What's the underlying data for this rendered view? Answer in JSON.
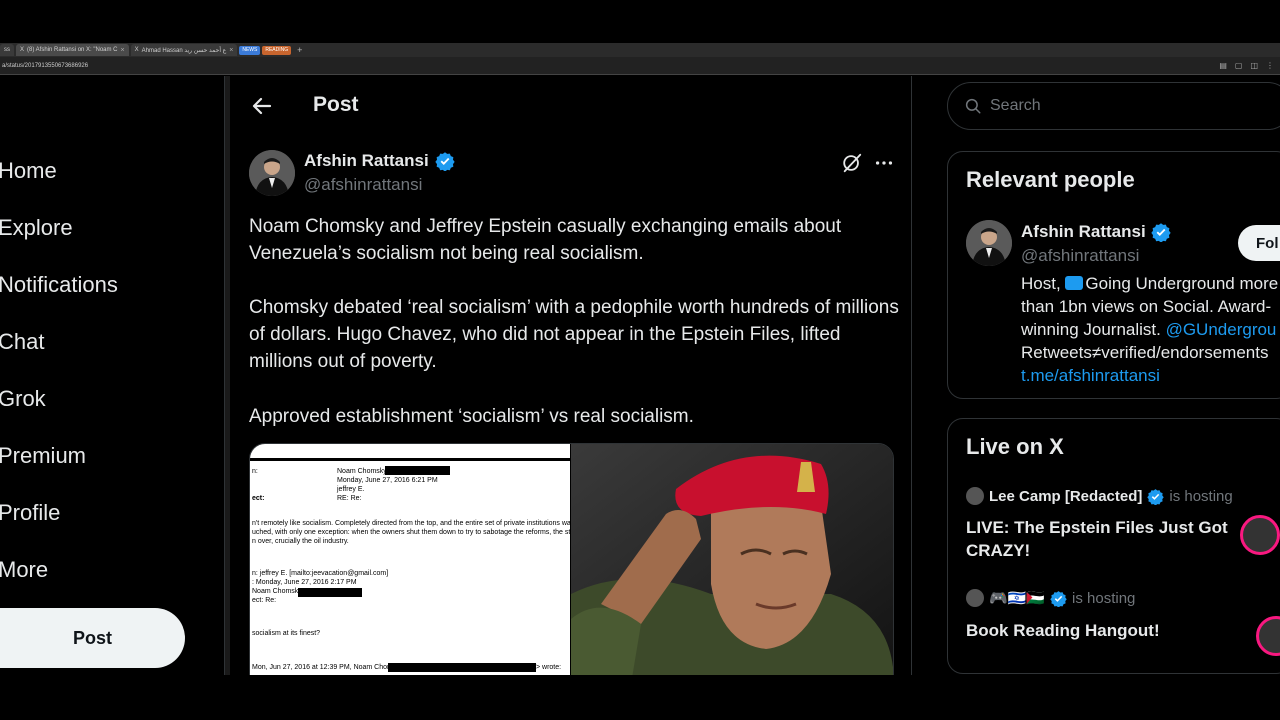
{
  "browser": {
    "tabs": [
      {
        "label": "ss"
      },
      {
        "label": "(8) Afshin Rattansi on X: \"Noam C"
      },
      {
        "label": "Ahmad Hassan ع أحمد حسن ريد"
      }
    ],
    "chips": [
      "NEWS",
      "READING"
    ],
    "new_tab": "+",
    "url": "a/status/2017913550673686926"
  },
  "nav": {
    "items": [
      "Home",
      "Explore",
      "Notifications",
      "Chat",
      "Grok",
      "Premium",
      "Profile",
      "More"
    ],
    "post_button": "Post"
  },
  "header": {
    "title": "Post"
  },
  "tweet": {
    "author_name": "Afshin Rattansi",
    "author_handle": "@afshinrattansi",
    "paragraphs": [
      "Noam Chomsky and Jeffrey Epstein casually exchanging emails about Venezuela’s socialism not being real socialism.",
      "Chomsky debated ‘real socialism’ with a pedophile worth hundreds of millions of dollars. Hugo Chavez, who did not appear in the Epstein Files, lifted millions out of poverty.",
      "Approved establishment ‘socialism’ vs real socialism."
    ],
    "email_doc": {
      "lines": [
        "n:",
        "Noam Chomsky",
        "Monday, June 27, 2016 6:21 PM",
        "jeffrey E.",
        "ect:",
        "RE: Re:",
        "n't remotely like socialism.  Completely directed from the top, and the entire set of private institutions was left",
        "uched, with only one exception: when the owners shut them down to try to sabotage the reforms, the state too",
        "n over, crucially the oil industry.",
        "n: jeffrey E. [mailto:jeevacation@gmail.com]",
        ": Monday, June 27, 2016 2:17 PM",
        "Noam Chomsky <",
        "ect: Re:",
        "socialism at its finest?",
        "Mon, Jun 27, 2016 at 12:39 PM, Noam Chomsky <",
        "> wrote:"
      ]
    }
  },
  "right": {
    "search_placeholder": "Search",
    "relevant": {
      "title": "Relevant people",
      "name": "Afshin Rattansi",
      "handle": "@afshinrattansi",
      "follow_label": "Fol",
      "bio_line1_pre": "Host, ",
      "bio_line1_post": "Going Underground more",
      "bio_line2": "than 1bn views on Social. Award-",
      "bio_line3_pre": "winning Journalist. ",
      "bio_line3_link": "@GUndergrou",
      "bio_line4": "Retweets≠verified/endorsements",
      "bio_line5_link": "t.me/afshinrattansi"
    },
    "live": {
      "title": "Live on X",
      "spaces": [
        {
          "host": "Lee Camp [Redacted]",
          "status": "is hosting",
          "title": "LIVE: The Epstein Files Just Got CRAZY!"
        },
        {
          "host": "🎮🇮🇱🇵🇸",
          "status": "is hosting",
          "title": "Book Reading Hangout!"
        }
      ]
    }
  },
  "colors": {
    "background": "#000000",
    "text": "#e7e9ea",
    "muted": "#71767b",
    "accent": "#1d9bf0",
    "border": "#2f3336",
    "live_ring": "#f91880",
    "beret": "#c8102e"
  }
}
